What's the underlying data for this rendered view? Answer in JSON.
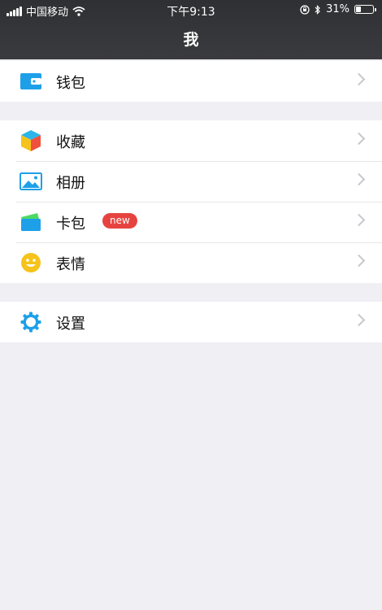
{
  "status_bar": {
    "carrier": "中国移动",
    "time": "下午9:13",
    "battery": "31%",
    "battery_level": 0.31
  },
  "nav": {
    "title": "我"
  },
  "groups": [
    {
      "items": [
        {
          "label": "钱包",
          "icon": "wallet-icon"
        }
      ]
    },
    {
      "items": [
        {
          "label": "收藏",
          "icon": "cube-favorites-icon"
        },
        {
          "label": "相册",
          "icon": "photo-album-icon"
        },
        {
          "label": "卡包",
          "icon": "card-wallet-icon",
          "badge": "new"
        },
        {
          "label": "表情",
          "icon": "smiley-icon"
        }
      ]
    },
    {
      "items": [
        {
          "label": "设置",
          "icon": "gear-icon"
        }
      ]
    }
  ],
  "colors": {
    "accent_blue": "#1ea0e9",
    "badge_red": "#e64340",
    "smiley_yellow": "#f5c31b",
    "card_green": "#4cd964"
  }
}
